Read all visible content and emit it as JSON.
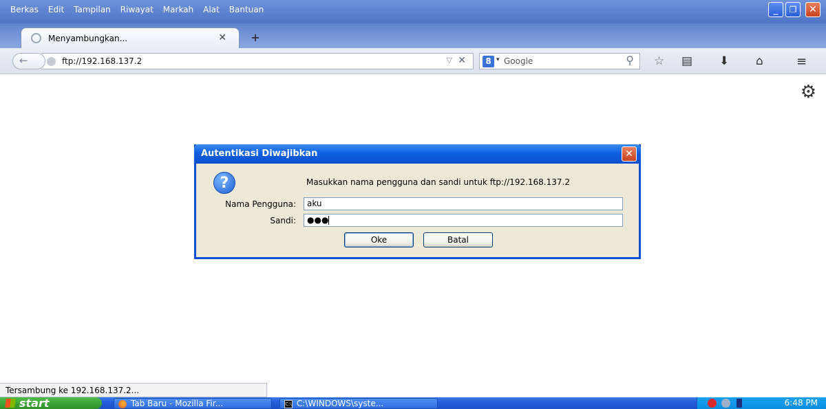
{
  "menu": {
    "items": [
      {
        "label": "Berkas"
      },
      {
        "label": "Edit"
      },
      {
        "label": "Tampilan"
      },
      {
        "label": "Riwayat"
      },
      {
        "label": "Markah"
      },
      {
        "label": "Alat"
      },
      {
        "label": "Bantuan"
      }
    ]
  },
  "window_controls": {
    "minimize": "_",
    "maximize": "❐",
    "close": "✕"
  },
  "tab": {
    "title": "Menyambungkan...",
    "close": "✕",
    "new_tab": "+"
  },
  "navbar": {
    "back": "←",
    "url": "ftp://192.168.137.2",
    "url_dropdown": "▽",
    "url_stop": "✕",
    "search_engine": "8",
    "search_dropdown": "▾",
    "search_placeholder": "Google",
    "search_go": "⚲",
    "star": "☆",
    "bookmarks": "▤",
    "downloads": "⬇",
    "home": "⌂",
    "menu": "≡"
  },
  "content": {
    "settings_icon": "⚙"
  },
  "dialog": {
    "title": "Autentikasi Diwajibkan",
    "close": "✕",
    "question": "?",
    "message": "Masukkan nama pengguna dan sandi untuk ftp://192.168.137.2",
    "username_label": "Nama Pengguna:",
    "username_value": "aku",
    "password_label": "Sandi:",
    "password_value": "●●●",
    "ok_label": "Oke",
    "cancel_label": "Batal"
  },
  "status": {
    "text": "Tersambung ke 192.168.137.2..."
  },
  "taskbar": {
    "start_label": "start",
    "cmd_icon": "C:\\",
    "tasks": [
      {
        "label": "Tab Baru - Mozilla Fir..."
      },
      {
        "label": "C:\\WINDOWS\\syste..."
      }
    ],
    "clock": "6:48 PM"
  },
  "colors": {
    "title_bar": "#5b80cf",
    "dialog_title": "#0f5fe0",
    "dialog_bg": "#ece9d8",
    "taskbar": "#245edb",
    "start_button": "#3fa83a"
  }
}
